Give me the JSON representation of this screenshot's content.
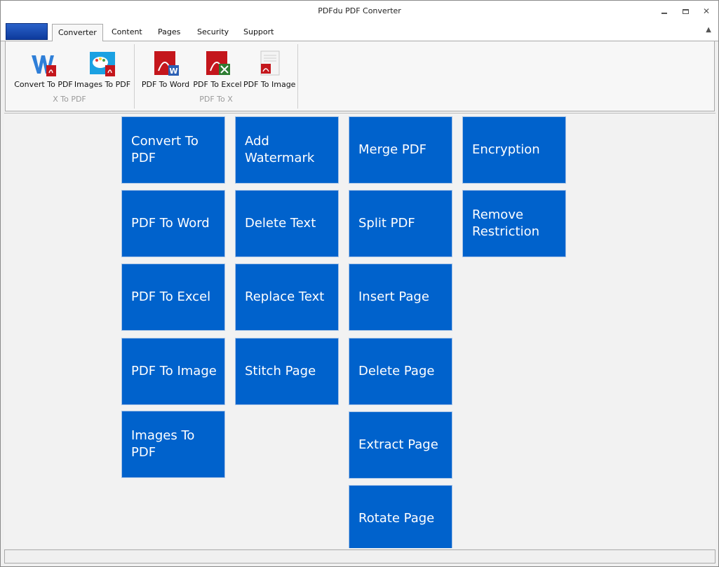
{
  "window": {
    "title": "PDFdu PDF Converter"
  },
  "ribbon": {
    "tabs": [
      "Converter",
      "Content",
      "Pages",
      "Security",
      "Support"
    ],
    "active_tab": "Converter",
    "groups": [
      {
        "title": "X To PDF",
        "buttons": [
          "Convert To PDF",
          "Images To PDF"
        ]
      },
      {
        "title": "PDF To X",
        "buttons": [
          "PDF To Word",
          "PDF To Excel",
          "PDF To Image"
        ]
      }
    ]
  },
  "tiles": {
    "col1": [
      "Convert To PDF",
      "PDF To Word",
      "PDF To Excel",
      "PDF To Image",
      "Images To PDF"
    ],
    "col2": [
      "Add Watermark",
      "Delete Text",
      "Replace Text",
      "Stitch Page"
    ],
    "col3": [
      "Merge PDF",
      "Split PDF",
      "Insert Page",
      "Delete Page",
      "Extract Page",
      "Rotate Page"
    ],
    "col4": [
      "Encryption",
      "Remove Restriction"
    ]
  },
  "colors": {
    "tile": "#0062cc",
    "app_button": "#1a4fb5"
  }
}
